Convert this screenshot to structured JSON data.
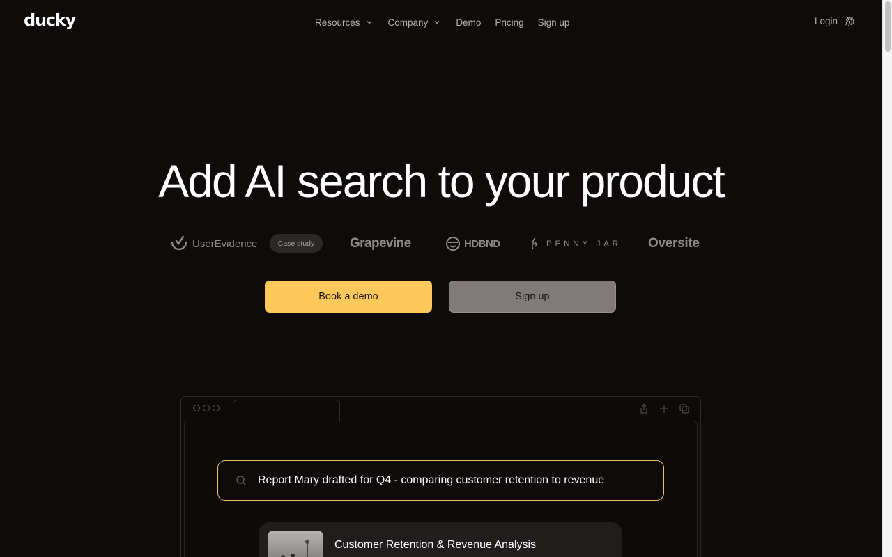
{
  "nav": {
    "logo": "ducky",
    "links": [
      {
        "label": "Resources",
        "dropdown": true
      },
      {
        "label": "Company",
        "dropdown": true
      },
      {
        "label": "Demo"
      },
      {
        "label": "Pricing"
      },
      {
        "label": "Sign up"
      }
    ],
    "login": "Login",
    "login_icon": "fingerprint-icon"
  },
  "hero": {
    "title": "Add AI search to your product",
    "logos": [
      {
        "name": "UserEvidence",
        "icon": "check-mark-icon"
      },
      {
        "name": "Grapevine"
      },
      {
        "name": "HDBND",
        "icon": "face-icon"
      },
      {
        "name": "PENNY JAR",
        "icon": "flame-icon"
      },
      {
        "name": "Oversite"
      }
    ],
    "case_study_badge": "Case study",
    "primary_button": "Book a demo",
    "secondary_button": "Sign up"
  },
  "demo": {
    "search_query": "Report Mary drafted for Q4 - comparing customer retention to revenue",
    "result_title": "Customer Retention & Revenue Analysis"
  },
  "colors": {
    "background": "#0f0b0b",
    "accent": "#fec85a",
    "search_border": "#e9c170",
    "secondary_button": "#807a7a"
  }
}
